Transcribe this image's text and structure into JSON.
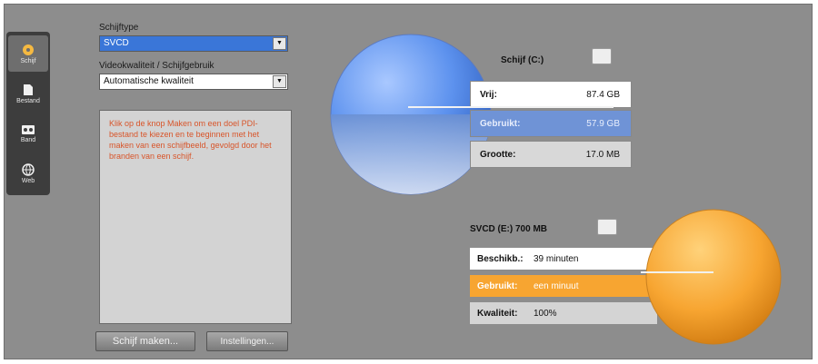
{
  "rail": {
    "items": [
      {
        "label": "Schijf",
        "icon": "disc-icon",
        "active": true
      },
      {
        "label": "Bestand",
        "icon": "file-icon",
        "active": false
      },
      {
        "label": "Band",
        "icon": "tape-icon",
        "active": false
      },
      {
        "label": "Web",
        "icon": "globe-icon",
        "active": false
      }
    ]
  },
  "settings": {
    "disc_type_label": "Schijftype",
    "disc_type_value": "SVCD",
    "quality_label": "Videokwaliteit / Schijfgebruik",
    "quality_value": "Automatische kwaliteit",
    "note_text": "Klik op de knop Maken om een doel PDI-bestand te kiezen en te beginnen met het maken van een schijfbeeld, gevolgd door het branden van een schijf."
  },
  "buttons": {
    "make_label": "Schijf maken...",
    "settings_label": "Instellingen..."
  },
  "disk_c": {
    "title": "Schijf (C:)",
    "rows": [
      {
        "key": "Vrij:",
        "value": "87.4 GB"
      },
      {
        "key": "Gebruikt:",
        "value": "57.9 GB"
      },
      {
        "key": "Grootte:",
        "value": "17.0 MB"
      }
    ],
    "free_fraction": 0.6
  },
  "disk_e": {
    "title": "SVCD (E:) 700 MB",
    "rows": [
      {
        "key": "Beschikb.:",
        "value": "39 minuten"
      },
      {
        "key": "Gebruikt:",
        "value": "een minuut"
      },
      {
        "key": "Kwaliteit:",
        "value": "100%"
      }
    ]
  },
  "colors": {
    "accent_blue": "#3a76d8",
    "accent_orange": "#f7a531",
    "note_text": "#d8552a"
  }
}
